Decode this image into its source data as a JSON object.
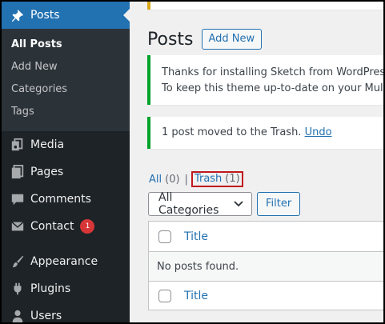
{
  "sidebar": {
    "posts_label": "Posts",
    "submenu": [
      "All Posts",
      "Add New",
      "Categories",
      "Tags"
    ],
    "items": [
      {
        "label": "Media"
      },
      {
        "label": "Pages"
      },
      {
        "label": "Comments"
      },
      {
        "label": "Contact",
        "badge": "1"
      },
      {
        "label": "Appearance"
      },
      {
        "label": "Plugins"
      },
      {
        "label": "Users"
      }
    ]
  },
  "main": {
    "page_title": "Posts",
    "add_new_label": "Add New",
    "notice_install_line1": "Thanks for installing Sketch from WordPress.com",
    "notice_install_line2": "To keep this theme up-to-date on your Multisite",
    "notice_trash_text": "1 post moved to the Trash.",
    "notice_undo": "Undo",
    "filter_all": "All",
    "filter_all_count": "(0)",
    "filter_sep": "|",
    "filter_trash": "Trash",
    "filter_trash_count": "(1)",
    "category_select": "All Categories",
    "filter_button": "Filter",
    "table": {
      "header_title": "Title",
      "empty_message": "No posts found.",
      "footer_title": "Title"
    }
  },
  "colors": {
    "sidebar_bg": "#1d2327",
    "active_blue": "#2271b1",
    "badge_red": "#d63638",
    "notice_green": "#00a32a",
    "highlight_red": "#c0181c"
  }
}
